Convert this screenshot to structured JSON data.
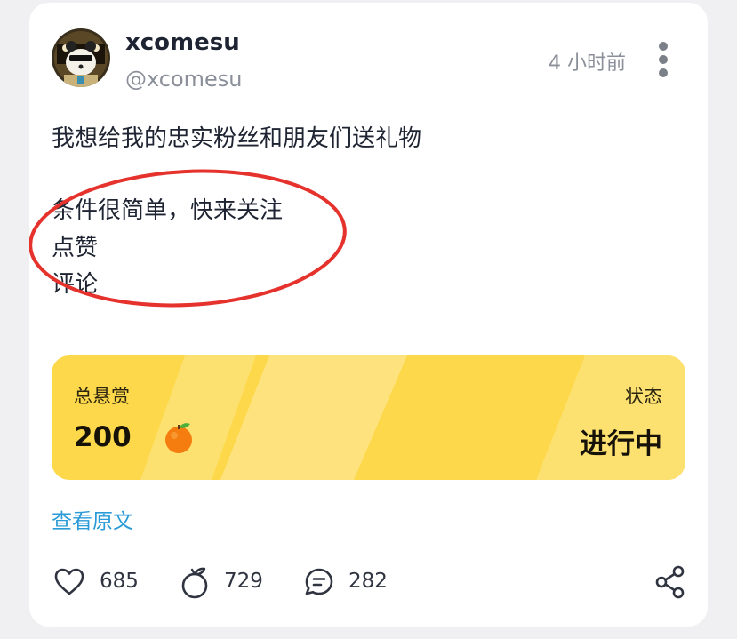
{
  "post": {
    "author_name": "xcomesu",
    "author_handle": "@xcomesu",
    "timestamp": "4 小时前",
    "body_line1": "我想给我的忠实粉丝和朋友们送礼物",
    "body_line2": "条件很简单，快来关注",
    "body_line3": "点赞",
    "body_line4": "评论"
  },
  "bounty": {
    "total_label": "总悬赏",
    "total_amount": "200",
    "currency_icon": "orange-icon",
    "status_label": "状态",
    "status_value": "进行中",
    "accent_color": "#fdd84a"
  },
  "links": {
    "view_original": "查看原文",
    "link_color": "#2a9bd7"
  },
  "actions": {
    "like_count": "685",
    "orange_count": "729",
    "comment_count": "282"
  },
  "annotation": {
    "ellipse_color": "#e5322c"
  }
}
